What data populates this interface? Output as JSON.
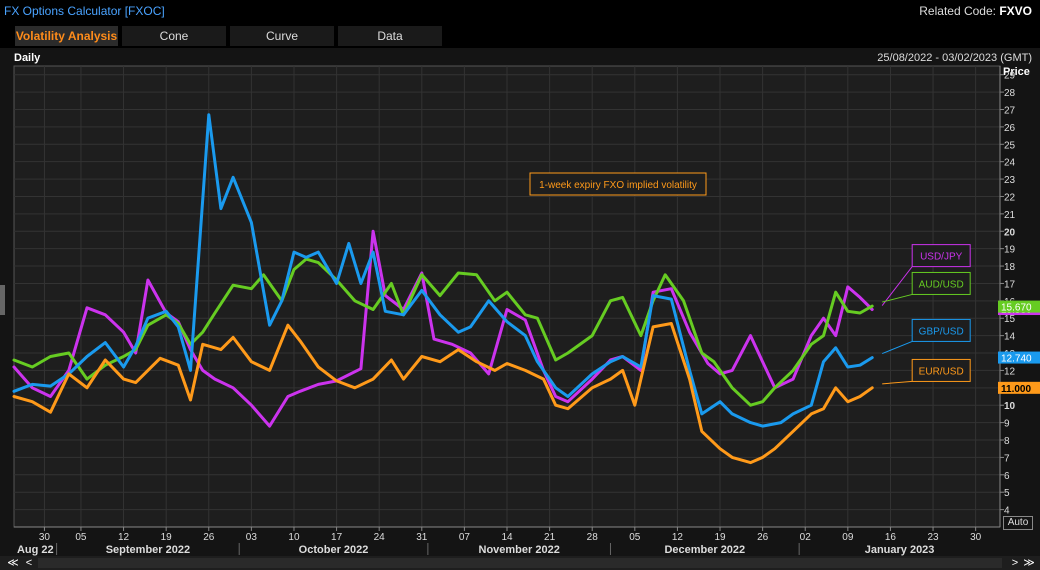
{
  "app": {
    "title": "FX Options Calculator [FXOC]",
    "related_label": "Related Code:",
    "related_code": "FXVO"
  },
  "tabs": [
    {
      "label": "Volatility Analysis",
      "active": true
    },
    {
      "label": "Cone",
      "active": false
    },
    {
      "label": "Curve",
      "active": false
    },
    {
      "label": "Data",
      "active": false
    }
  ],
  "chart_header": {
    "frequency": "Daily",
    "date_range": "25/08/2022 - 03/02/2023 (GMT)",
    "price_label": "Price",
    "auto_label": "Auto"
  },
  "scroll": {
    "first": "≪",
    "prev": "<",
    "next": ">",
    "last": "≫"
  },
  "chart_data": {
    "type": "line",
    "annotation": "1-week expiry FXO implied volatility",
    "ylim": [
      3,
      29.5
    ],
    "xlim": [
      "2022-08-25",
      "2023-02-03"
    ],
    "y_ticks": [
      4,
      5,
      6,
      7,
      8,
      9,
      10,
      11,
      12,
      13,
      14,
      15,
      16,
      17,
      18,
      19,
      20,
      21,
      22,
      23,
      24,
      25,
      26,
      27,
      28,
      29
    ],
    "x_ticks": [
      {
        "date": "2022-08-30",
        "label": "30"
      },
      {
        "date": "2022-09-05",
        "label": "05"
      },
      {
        "date": "2022-09-12",
        "label": "12"
      },
      {
        "date": "2022-09-19",
        "label": "19"
      },
      {
        "date": "2022-09-26",
        "label": "26"
      },
      {
        "date": "2022-10-03",
        "label": "03"
      },
      {
        "date": "2022-10-10",
        "label": "10"
      },
      {
        "date": "2022-10-17",
        "label": "17"
      },
      {
        "date": "2022-10-24",
        "label": "24"
      },
      {
        "date": "2022-10-31",
        "label": "31"
      },
      {
        "date": "2022-11-07",
        "label": "07"
      },
      {
        "date": "2022-11-14",
        "label": "14"
      },
      {
        "date": "2022-11-21",
        "label": "21"
      },
      {
        "date": "2022-11-28",
        "label": "28"
      },
      {
        "date": "2022-12-05",
        "label": "05"
      },
      {
        "date": "2022-12-12",
        "label": "12"
      },
      {
        "date": "2022-12-19",
        "label": "19"
      },
      {
        "date": "2022-12-26",
        "label": "26"
      },
      {
        "date": "2023-01-02",
        "label": "02"
      },
      {
        "date": "2023-01-09",
        "label": "09"
      },
      {
        "date": "2023-01-16",
        "label": "16"
      },
      {
        "date": "2023-01-23",
        "label": "23"
      },
      {
        "date": "2023-01-30",
        "label": "30"
      }
    ],
    "months": [
      {
        "label": "Aug 22",
        "start": "2022-08-25",
        "end": "2022-08-31"
      },
      {
        "label": "September 2022",
        "start": "2022-09-01",
        "end": "2022-09-30"
      },
      {
        "label": "October 2022",
        "start": "2022-10-01",
        "end": "2022-10-31"
      },
      {
        "label": "November 2022",
        "start": "2022-11-01",
        "end": "2022-11-30"
      },
      {
        "label": "December 2022",
        "start": "2022-12-01",
        "end": "2022-12-31"
      },
      {
        "label": "January 2023",
        "start": "2023-01-01",
        "end": "2023-02-03"
      }
    ],
    "series": [
      {
        "name": "USD/JPY",
        "color": "#cc33ee",
        "last": "15.530",
        "last_value": 15.53,
        "label_value": 18.6,
        "points": [
          [
            "2022-08-25",
            12.2
          ],
          [
            "2022-08-28",
            11.0
          ],
          [
            "2022-08-31",
            10.5
          ],
          [
            "2022-09-03",
            12.0
          ],
          [
            "2022-09-06",
            15.6
          ],
          [
            "2022-09-09",
            15.2
          ],
          [
            "2022-09-12",
            14.2
          ],
          [
            "2022-09-14",
            13.0
          ],
          [
            "2022-09-16",
            17.2
          ],
          [
            "2022-09-19",
            15.3
          ],
          [
            "2022-09-21",
            14.8
          ],
          [
            "2022-09-23",
            13.2
          ],
          [
            "2022-09-25",
            12.0
          ],
          [
            "2022-09-27",
            11.5
          ],
          [
            "2022-09-30",
            11.0
          ],
          [
            "2022-10-03",
            10.0
          ],
          [
            "2022-10-06",
            8.8
          ],
          [
            "2022-10-09",
            10.5
          ],
          [
            "2022-10-11",
            10.8
          ],
          [
            "2022-10-14",
            11.2
          ],
          [
            "2022-10-17",
            11.4
          ],
          [
            "2022-10-21",
            12.1
          ],
          [
            "2022-10-23",
            20.0
          ],
          [
            "2022-10-25",
            16.3
          ],
          [
            "2022-10-28",
            15.5
          ],
          [
            "2022-10-31",
            17.6
          ],
          [
            "2022-11-02",
            13.8
          ],
          [
            "2022-11-05",
            13.5
          ],
          [
            "2022-11-08",
            13.0
          ],
          [
            "2022-11-11",
            11.8
          ],
          [
            "2022-11-14",
            15.5
          ],
          [
            "2022-11-17",
            14.9
          ],
          [
            "2022-11-20",
            12.0
          ],
          [
            "2022-11-22",
            10.5
          ],
          [
            "2022-11-24",
            10.2
          ],
          [
            "2022-11-28",
            11.5
          ],
          [
            "2022-12-01",
            12.6
          ],
          [
            "2022-12-03",
            12.8
          ],
          [
            "2022-12-06",
            12.0
          ],
          [
            "2022-12-08",
            16.5
          ],
          [
            "2022-12-11",
            16.7
          ],
          [
            "2022-12-14",
            14.2
          ],
          [
            "2022-12-17",
            12.4
          ],
          [
            "2022-12-19",
            11.8
          ],
          [
            "2022-12-21",
            12.0
          ],
          [
            "2022-12-24",
            14.0
          ],
          [
            "2022-12-26",
            12.5
          ],
          [
            "2022-12-28",
            11.0
          ],
          [
            "2022-12-31",
            11.5
          ],
          [
            "2023-01-03",
            14.0
          ],
          [
            "2023-01-05",
            15.0
          ],
          [
            "2023-01-07",
            14.0
          ],
          [
            "2023-01-09",
            16.8
          ],
          [
            "2023-01-11",
            16.2
          ],
          [
            "2023-01-13",
            15.5
          ]
        ]
      },
      {
        "name": "AUD/USD",
        "color": "#66cc22",
        "last": "15.670",
        "last_value": 15.67,
        "label_value": 17.0,
        "points": [
          [
            "2022-08-25",
            12.6
          ],
          [
            "2022-08-28",
            12.2
          ],
          [
            "2022-08-31",
            12.8
          ],
          [
            "2022-09-03",
            13.0
          ],
          [
            "2022-09-06",
            11.5
          ],
          [
            "2022-09-09",
            12.3
          ],
          [
            "2022-09-12",
            12.8
          ],
          [
            "2022-09-14",
            13.2
          ],
          [
            "2022-09-16",
            14.6
          ],
          [
            "2022-09-19",
            15.2
          ],
          [
            "2022-09-21",
            14.7
          ],
          [
            "2022-09-23",
            13.5
          ],
          [
            "2022-09-25",
            14.2
          ],
          [
            "2022-09-27",
            15.3
          ],
          [
            "2022-09-30",
            16.9
          ],
          [
            "2022-10-03",
            16.7
          ],
          [
            "2022-10-05",
            17.5
          ],
          [
            "2022-10-08",
            16.0
          ],
          [
            "2022-10-10",
            17.8
          ],
          [
            "2022-10-12",
            18.4
          ],
          [
            "2022-10-14",
            18.2
          ],
          [
            "2022-10-17",
            17.2
          ],
          [
            "2022-10-20",
            16.0
          ],
          [
            "2022-10-23",
            15.5
          ],
          [
            "2022-10-26",
            17.0
          ],
          [
            "2022-10-28",
            15.2
          ],
          [
            "2022-10-31",
            17.5
          ],
          [
            "2022-11-03",
            16.3
          ],
          [
            "2022-11-06",
            17.6
          ],
          [
            "2022-11-09",
            17.5
          ],
          [
            "2022-11-12",
            16.0
          ],
          [
            "2022-11-14",
            16.5
          ],
          [
            "2022-11-17",
            15.2
          ],
          [
            "2022-11-19",
            15.0
          ],
          [
            "2022-11-22",
            12.6
          ],
          [
            "2022-11-24",
            13.0
          ],
          [
            "2022-11-28",
            14.0
          ],
          [
            "2022-12-01",
            16.0
          ],
          [
            "2022-12-03",
            16.2
          ],
          [
            "2022-12-06",
            14.0
          ],
          [
            "2022-12-08",
            16.0
          ],
          [
            "2022-12-10",
            17.5
          ],
          [
            "2022-12-13",
            16.0
          ],
          [
            "2022-12-16",
            13.0
          ],
          [
            "2022-12-18",
            12.5
          ],
          [
            "2022-12-21",
            11.0
          ],
          [
            "2022-12-24",
            10.0
          ],
          [
            "2022-12-26",
            10.2
          ],
          [
            "2022-12-28",
            11.0
          ],
          [
            "2022-12-31",
            12.0
          ],
          [
            "2023-01-03",
            13.5
          ],
          [
            "2023-01-05",
            14.0
          ],
          [
            "2023-01-07",
            16.5
          ],
          [
            "2023-01-09",
            15.4
          ],
          [
            "2023-01-11",
            15.3
          ],
          [
            "2023-01-13",
            15.7
          ]
        ]
      },
      {
        "name": "GBP/USD",
        "color": "#1a9aee",
        "last": "12.740",
        "last_value": 12.74,
        "label_value": 14.3,
        "points": [
          [
            "2022-08-25",
            10.8
          ],
          [
            "2022-08-28",
            11.2
          ],
          [
            "2022-08-31",
            11.1
          ],
          [
            "2022-09-03",
            11.8
          ],
          [
            "2022-09-06",
            12.8
          ],
          [
            "2022-09-09",
            13.6
          ],
          [
            "2022-09-12",
            12.2
          ],
          [
            "2022-09-14",
            13.4
          ],
          [
            "2022-09-16",
            15.0
          ],
          [
            "2022-09-19",
            15.4
          ],
          [
            "2022-09-21",
            14.5
          ],
          [
            "2022-09-23",
            12.0
          ],
          [
            "2022-09-26",
            26.7
          ],
          [
            "2022-09-28",
            21.3
          ],
          [
            "2022-09-30",
            23.1
          ],
          [
            "2022-10-03",
            20.5
          ],
          [
            "2022-10-06",
            14.6
          ],
          [
            "2022-10-08",
            16.0
          ],
          [
            "2022-10-10",
            18.8
          ],
          [
            "2022-10-12",
            18.5
          ],
          [
            "2022-10-14",
            18.8
          ],
          [
            "2022-10-17",
            17.0
          ],
          [
            "2022-10-19",
            19.3
          ],
          [
            "2022-10-21",
            17.0
          ],
          [
            "2022-10-23",
            18.8
          ],
          [
            "2022-10-25",
            15.4
          ],
          [
            "2022-10-28",
            15.2
          ],
          [
            "2022-10-31",
            16.6
          ],
          [
            "2022-11-03",
            15.2
          ],
          [
            "2022-11-06",
            14.2
          ],
          [
            "2022-11-08",
            14.5
          ],
          [
            "2022-11-11",
            16.0
          ],
          [
            "2022-11-14",
            14.8
          ],
          [
            "2022-11-17",
            14.0
          ],
          [
            "2022-11-19",
            12.5
          ],
          [
            "2022-11-22",
            11.0
          ],
          [
            "2022-11-24",
            10.5
          ],
          [
            "2022-11-28",
            11.8
          ],
          [
            "2022-12-01",
            12.5
          ],
          [
            "2022-12-03",
            12.8
          ],
          [
            "2022-12-06",
            12.2
          ],
          [
            "2022-12-08",
            16.3
          ],
          [
            "2022-12-11",
            16.1
          ],
          [
            "2022-12-14",
            12.0
          ],
          [
            "2022-12-16",
            9.5
          ],
          [
            "2022-12-19",
            10.2
          ],
          [
            "2022-12-21",
            9.5
          ],
          [
            "2022-12-24",
            9.0
          ],
          [
            "2022-12-26",
            8.8
          ],
          [
            "2022-12-29",
            9.0
          ],
          [
            "2022-12-31",
            9.5
          ],
          [
            "2023-01-03",
            10.0
          ],
          [
            "2023-01-05",
            12.5
          ],
          [
            "2023-01-07",
            13.3
          ],
          [
            "2023-01-09",
            12.2
          ],
          [
            "2023-01-11",
            12.3
          ],
          [
            "2023-01-13",
            12.74
          ]
        ]
      },
      {
        "name": "EUR/USD",
        "color": "#ff9a1a",
        "last": "11.000",
        "last_value": 11.0,
        "label_value": 12.0,
        "points": [
          [
            "2022-08-25",
            10.5
          ],
          [
            "2022-08-28",
            10.2
          ],
          [
            "2022-08-31",
            9.6
          ],
          [
            "2022-09-03",
            11.8
          ],
          [
            "2022-09-06",
            11.0
          ],
          [
            "2022-09-09",
            12.6
          ],
          [
            "2022-09-12",
            11.5
          ],
          [
            "2022-09-14",
            11.3
          ],
          [
            "2022-09-16",
            12.0
          ],
          [
            "2022-09-18",
            12.7
          ],
          [
            "2022-09-21",
            12.3
          ],
          [
            "2022-09-23",
            10.3
          ],
          [
            "2022-09-25",
            13.5
          ],
          [
            "2022-09-28",
            13.2
          ],
          [
            "2022-09-30",
            13.9
          ],
          [
            "2022-10-03",
            12.5
          ],
          [
            "2022-10-06",
            12.0
          ],
          [
            "2022-10-09",
            14.6
          ],
          [
            "2022-10-11",
            13.7
          ],
          [
            "2022-10-14",
            12.2
          ],
          [
            "2022-10-17",
            11.4
          ],
          [
            "2022-10-20",
            11.0
          ],
          [
            "2022-10-23",
            11.5
          ],
          [
            "2022-10-26",
            12.6
          ],
          [
            "2022-10-28",
            11.5
          ],
          [
            "2022-10-31",
            12.8
          ],
          [
            "2022-11-03",
            12.5
          ],
          [
            "2022-11-06",
            13.2
          ],
          [
            "2022-11-09",
            12.5
          ],
          [
            "2022-11-12",
            12.0
          ],
          [
            "2022-11-14",
            12.4
          ],
          [
            "2022-11-17",
            12.0
          ],
          [
            "2022-11-20",
            11.5
          ],
          [
            "2022-11-22",
            10.0
          ],
          [
            "2022-11-24",
            9.8
          ],
          [
            "2022-11-28",
            11.0
          ],
          [
            "2022-12-01",
            11.5
          ],
          [
            "2022-12-03",
            12.0
          ],
          [
            "2022-12-05",
            10.0
          ],
          [
            "2022-12-08",
            14.5
          ],
          [
            "2022-12-11",
            14.7
          ],
          [
            "2022-12-14",
            11.5
          ],
          [
            "2022-12-16",
            8.5
          ],
          [
            "2022-12-19",
            7.5
          ],
          [
            "2022-12-21",
            7.0
          ],
          [
            "2022-12-24",
            6.7
          ],
          [
            "2022-12-26",
            7.0
          ],
          [
            "2022-12-28",
            7.5
          ],
          [
            "2022-12-31",
            8.5
          ],
          [
            "2023-01-03",
            9.5
          ],
          [
            "2023-01-05",
            9.8
          ],
          [
            "2023-01-07",
            11.0
          ],
          [
            "2023-01-09",
            10.2
          ],
          [
            "2023-01-11",
            10.5
          ],
          [
            "2023-01-13",
            11.0
          ]
        ]
      }
    ]
  }
}
